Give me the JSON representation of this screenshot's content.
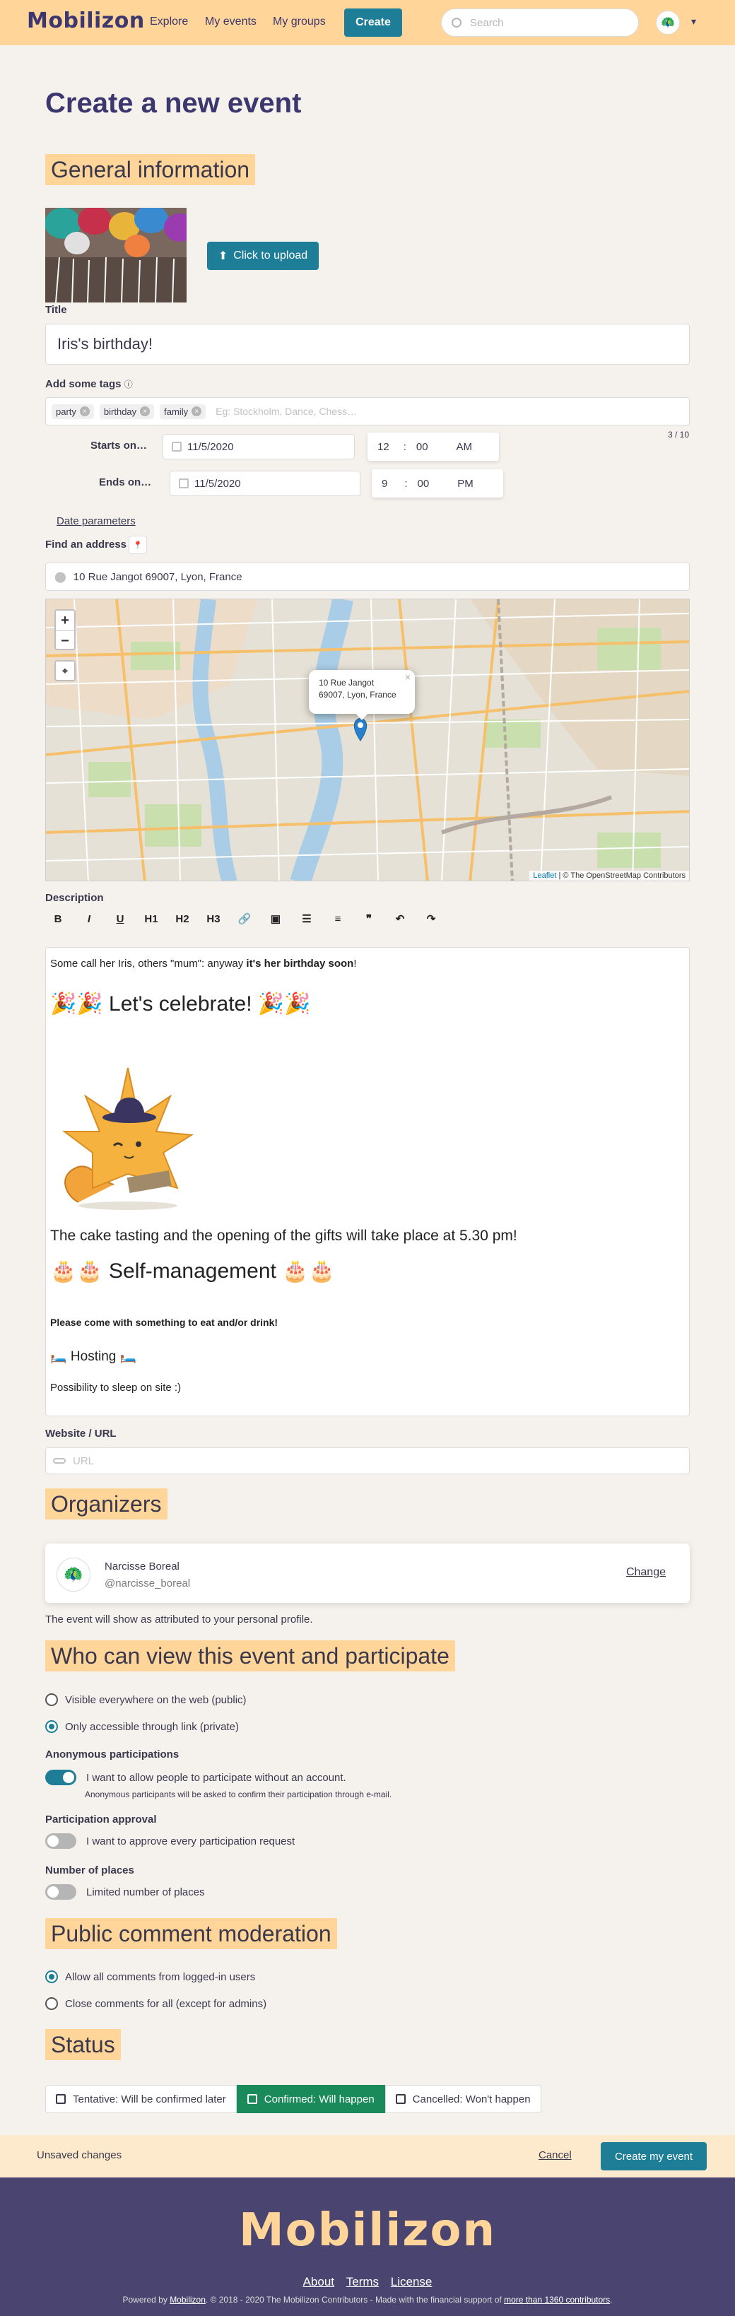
{
  "nav": {
    "logo": "Mobilizon",
    "links": [
      "Explore",
      "My events",
      "My groups"
    ],
    "create": "Create",
    "search_placeholder": "Search"
  },
  "page": {
    "title": "Create a new event",
    "general_heading": "General information",
    "upload_label": "Click to upload",
    "title_label": "Title",
    "title_value": "Iris's birthday!",
    "tags_label": "Add some tags",
    "tags": [
      "party",
      "birthday",
      "family"
    ],
    "tags_placeholder": "Eg: Stockholm, Dance, Chess…",
    "tags_count": "3 / 10",
    "starts_label": "Starts on…",
    "ends_label": "Ends on…",
    "start_date": "11/5/2020",
    "start_hour": "12",
    "start_min": "00",
    "start_ampm": "AM",
    "end_date": "11/5/2020",
    "end_hour": "9",
    "end_min": "00",
    "end_ampm": "PM",
    "date_params": "Date parameters",
    "find_address": "Find an address",
    "address_value": "10 Rue Jangot 69007, Lyon, France",
    "map_popup_line1": "10 Rue Jangot",
    "map_popup_line2": "69007, Lyon, France",
    "map_attrib_leaflet": "Leaflet",
    "map_attrib_rest": " | © The OpenStreetMap Contributors",
    "description_label": "Description",
    "toolbar": [
      "B",
      "I",
      "U",
      "H1",
      "H2",
      "H3",
      "🔗",
      "▣",
      "☰",
      "≡",
      "❞",
      "↶",
      "↷"
    ],
    "desc_p1_a": "Some call her Iris, others \"mum\": anyway ",
    "desc_p1_b": "it's her birthday soon",
    "desc_p1_c": "!",
    "desc_h_celebrate": "🎉🎉 Let's celebrate! 🎉🎉",
    "desc_cake": "The cake tasting and the opening of the gifts will take place at 5.30 pm!",
    "desc_h_self": "🎂🎂 Self-management 🎂🎂",
    "desc_bring": "Please come with something to eat and/or drink!",
    "desc_hosting": "🛏️ Hosting 🛏️",
    "desc_sleep": "Possibility to sleep on site :)",
    "website_label": "Website / URL",
    "url_placeholder": "URL",
    "organizers_heading": "Organizers",
    "org_name": "Narcisse Boreal",
    "org_handle": "@narcisse_boreal",
    "org_change": "Change",
    "org_note": "The event will show as attributed to your personal profile.",
    "visibility_heading": "Who can view this event and participate",
    "vis_public": "Visible everywhere on the web (public)",
    "vis_private": "Only accessible through link (private)",
    "anon_label": "Anonymous participations",
    "anon_toggle": "I want to allow people to participate without an account.",
    "anon_note": "Anonymous participants will be asked to confirm their participation through e-mail.",
    "approval_label": "Participation approval",
    "approval_toggle": "I want to approve every participation request",
    "places_label": "Number of places",
    "places_toggle": "Limited number of places",
    "comment_heading": "Public comment moderation",
    "comment_all": "Allow all comments from logged-in users",
    "comment_close": "Close comments for all (except for admins)",
    "status_heading": "Status",
    "status_tentative": "Tentative: Will be confirmed later",
    "status_confirmed": "Confirmed: Will happen",
    "status_cancelled": "Cancelled: Won't happen"
  },
  "bottom": {
    "unsaved": "Unsaved changes",
    "cancel": "Cancel",
    "create": "Create my event"
  },
  "footer": {
    "logo": "Mobilizon",
    "links": [
      "About",
      "Terms",
      "License"
    ],
    "copy_a": "Powered by ",
    "copy_mob": "Mobilizon",
    "copy_b": ". © 2018 - 2020 The Mobilizon Contributors - Made with the financial support of ",
    "copy_link": "more than 1360 contributors",
    "copy_c": "."
  },
  "colors": {
    "accent": "#1e7d97",
    "highlight": "#ffd599",
    "brand_dark": "#3c376e",
    "confirmed": "#1a8a5a"
  }
}
